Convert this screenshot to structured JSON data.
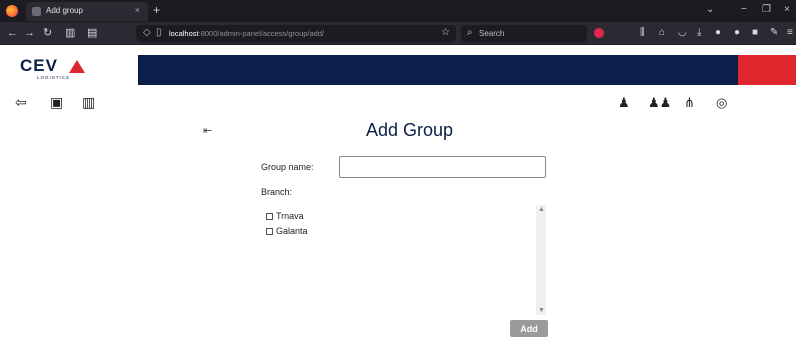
{
  "browser": {
    "tab_title": "Add group",
    "tab_close": "×",
    "new_tab": "+",
    "url_host": "localhost",
    "url_path": ":8000/admin-panel/access/group/add/",
    "search_placeholder": "Search",
    "window_controls": [
      "⌄",
      "−",
      "❐",
      "×"
    ]
  },
  "header": {
    "logo_text": "CEV",
    "logo_subtitle": "LOGISTICS",
    "colors": {
      "navy": "#0a1f4a",
      "red": "#e0262d"
    }
  },
  "left_icons": [
    "logout-icon",
    "user-card-icon",
    "map-icon"
  ],
  "right_icons": [
    "user-icon",
    "users-icon",
    "hierarchy-icon",
    "location-pin-icon"
  ],
  "form": {
    "back_arrow": "⇤",
    "title": "Add Group",
    "group_name_label": "Group name:",
    "group_name_value": "",
    "branch_label": "Branch:",
    "branches": [
      {
        "label": "Trnava",
        "checked": false
      },
      {
        "label": "Galanta",
        "checked": false
      }
    ],
    "submit_label": "Add"
  }
}
